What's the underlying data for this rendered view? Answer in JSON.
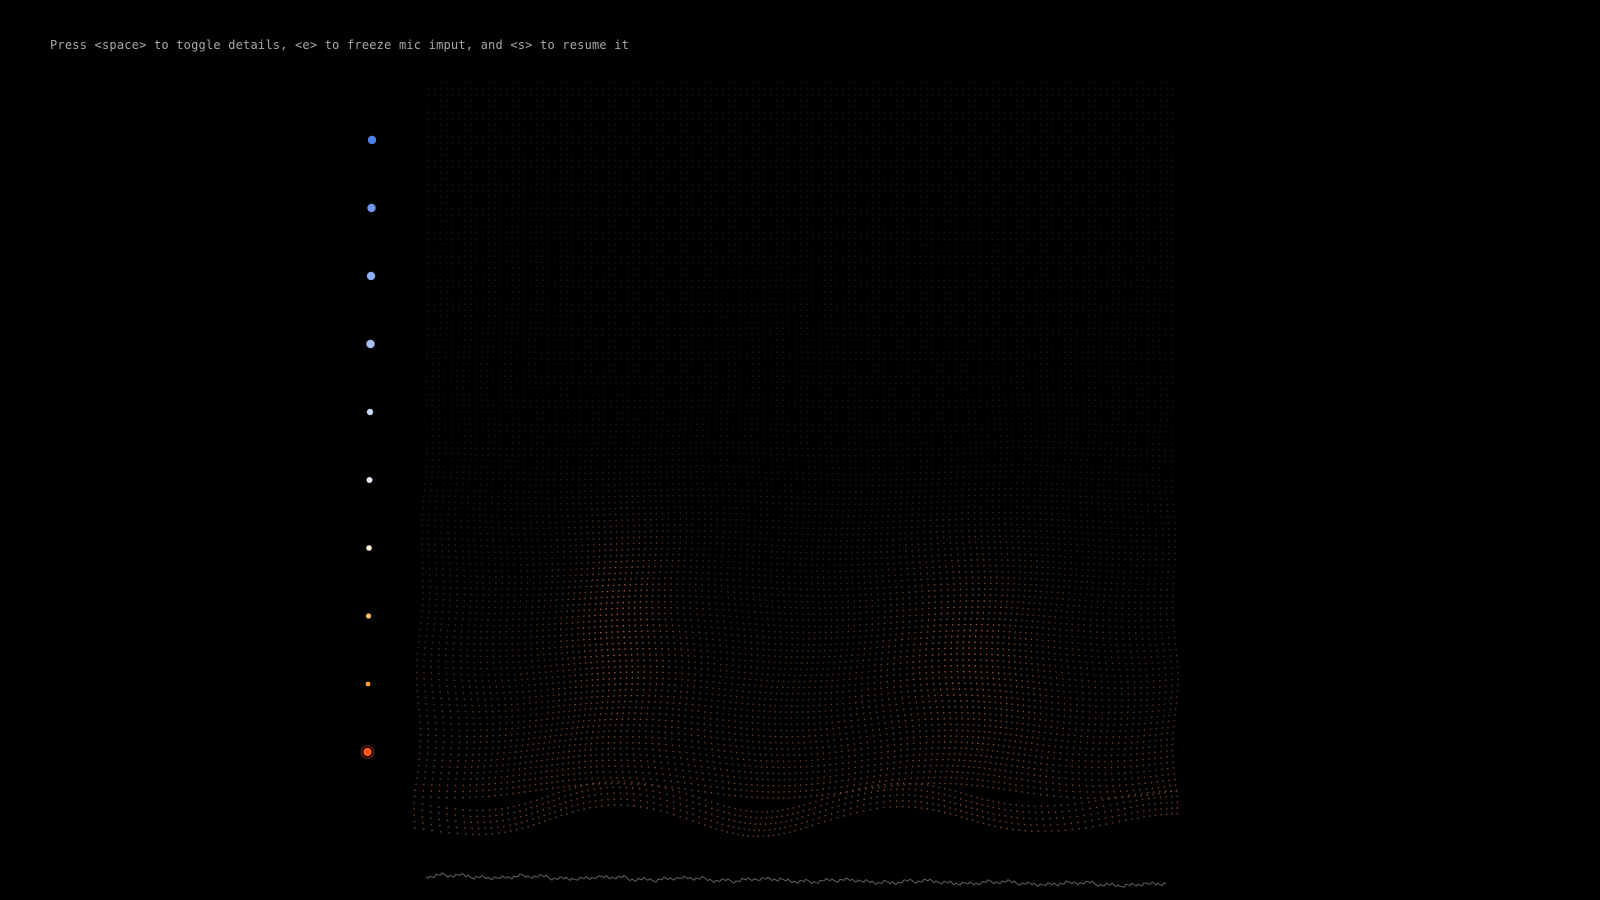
{
  "app": {
    "instructions": "Press <space> to toggle details, <e> to freeze mic imput, and <s> to resume it",
    "background_color": "#000000"
  },
  "visualization": {
    "description_kind": "audio-reactive dot grid",
    "color_scale": [
      "#4f7fe8",
      "#6f97ef",
      "#8eacf2",
      "#a9c0f5",
      "#c7d6f7",
      "#e6ecf7",
      "#fff4e0",
      "#ffc470",
      "#ff9a3a",
      "#ff5a1a"
    ],
    "grid_base_color": "#2a2a2a",
    "grid_warm_color": "#c86a3c",
    "waveform_color": "#8a8a8a"
  }
}
